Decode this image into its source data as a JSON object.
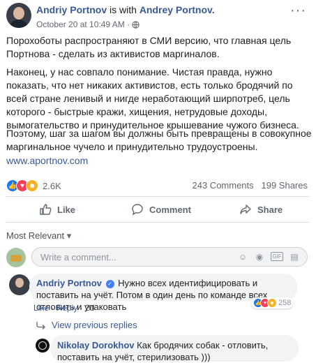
{
  "post": {
    "author": "Andriy Portnov",
    "with_text": "is with",
    "tagged": "Andrey Portnov.",
    "timestamp": "October 20 at 10:49 AM",
    "meta_sep": "·",
    "paragraphs": [
      "Порохоботы распространяют в СМИ версию, что главная цель Портнова - сделать из активистов маргиналов.",
      "Наконец, у нас совпало понимание. Чистая правда, нужно показать, что нет никаких активистов, есть только бродячий по всей стране ленивый и нигде неработающий ширпотреб, цель которого - быстрые кражи, хищения, нетрудовые доходы, вымогательство и принудительное крышевание чужого бизнеса.",
      "Поэтому, шаг за шагом вы должны быть превращены в совокупное маргинальное чучело и принудительно трудоустроены."
    ],
    "link": "www.aportnov.com",
    "more": "···"
  },
  "stats": {
    "reactions_count": "2.6K",
    "comments": "243 Comments",
    "shares": "199 Shares"
  },
  "actions": {
    "like": "Like",
    "comment": "Comment",
    "share": "Share"
  },
  "comments_section": {
    "filter": "Most Relevant",
    "filter_arrow": "▾",
    "write_placeholder": "Write a comment...",
    "icons": [
      "emoji-icon",
      "camera-icon",
      "gif-icon",
      "sticker-icon"
    ],
    "top_comment": {
      "author": "Andriy Portnov",
      "text": "Нужно всех идентифицировать и поставить на учёт. Потом в один день по команде всех отловить и упаковать",
      "reaction_count": "258",
      "like": "Like",
      "reply": "Reply",
      "age": "2d",
      "sep": "·"
    },
    "view_previous": "View previous replies",
    "reply": {
      "author": "Nikolay Dorokhov",
      "text": "Как бродячих собак - отловить, поставить на учёт, стерилизовать )))"
    }
  },
  "colors": {
    "link": "#385898",
    "like_blue": "#1877f2",
    "love_red": "#f33e58",
    "haha_yellow": "#f7b125"
  }
}
